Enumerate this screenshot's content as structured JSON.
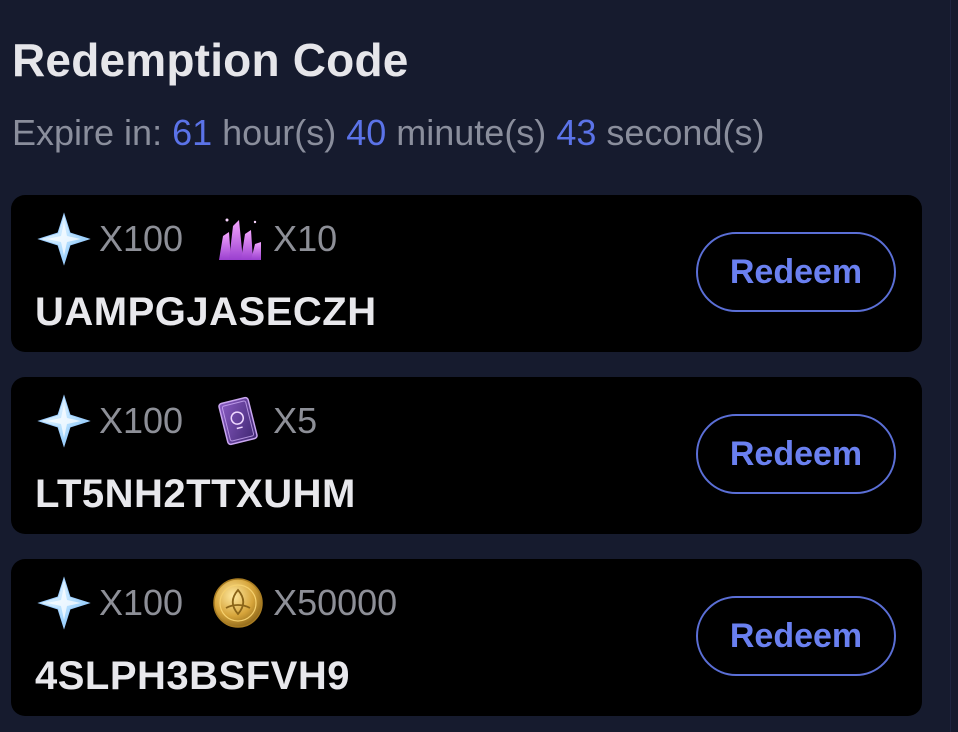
{
  "page": {
    "title": "Redemption Code"
  },
  "expire": {
    "label": "Expire in:",
    "hours": "61",
    "hours_unit": "hour(s)",
    "minutes": "40",
    "minutes_unit": "minute(s)",
    "seconds": "43",
    "seconds_unit": "second(s)"
  },
  "codes": [
    {
      "code": "UAMPGJASECZH",
      "rewards": [
        {
          "icon": "primogem-icon",
          "qty": "X100"
        },
        {
          "icon": "crystal-cluster-icon",
          "qty": "X10"
        }
      ],
      "button_label": "Redeem"
    },
    {
      "code": "LT5NH2TTXUHM",
      "rewards": [
        {
          "icon": "primogem-icon",
          "qty": "X100"
        },
        {
          "icon": "book-icon",
          "qty": "X5"
        }
      ],
      "button_label": "Redeem"
    },
    {
      "code": "4SLPH3BSFVH9",
      "rewards": [
        {
          "icon": "primogem-icon",
          "qty": "X100"
        },
        {
          "icon": "gold-coin-icon",
          "qty": "X50000"
        }
      ],
      "button_label": "Redeem"
    }
  ],
  "colors": {
    "background": "#161b2e",
    "card": "#000000",
    "accent": "#5b73e8",
    "title": "#e6e6ea",
    "muted": "#8a8e9c"
  }
}
